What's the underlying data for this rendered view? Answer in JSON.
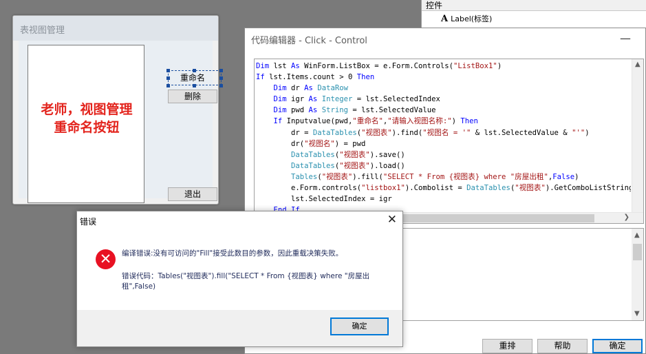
{
  "controls_panel": {
    "header": "控件",
    "item_label": "Label(标签)"
  },
  "form_window": {
    "title": "表视图管理",
    "rename_button": "重命名",
    "delete_button": "删除",
    "exit_button": "退出",
    "annotation": "老师，视图管理重命名按钮"
  },
  "code_editor": {
    "title": "代码编辑器 - Click - Control",
    "buttons": {
      "rearrange": "重排",
      "help": "帮助",
      "confirm": "确定"
    }
  },
  "error_dialog": {
    "title": "错误",
    "message": "编译错误:没有可访问的\"Fill\"接受此数目的参数，因此重载决策失败。",
    "code_line": "错误代码：Tables(\"视图表\").fill(\"SELECT * From {视图表} where \"房屋出租\",False)",
    "ok_button": "确定"
  },
  "colors": {
    "annotation": "#e3241d",
    "error_icon": "#e81123",
    "primary_border": "#0078d7",
    "keyword": "#0000ff",
    "string": "#a31515",
    "type": "#2b91af"
  }
}
